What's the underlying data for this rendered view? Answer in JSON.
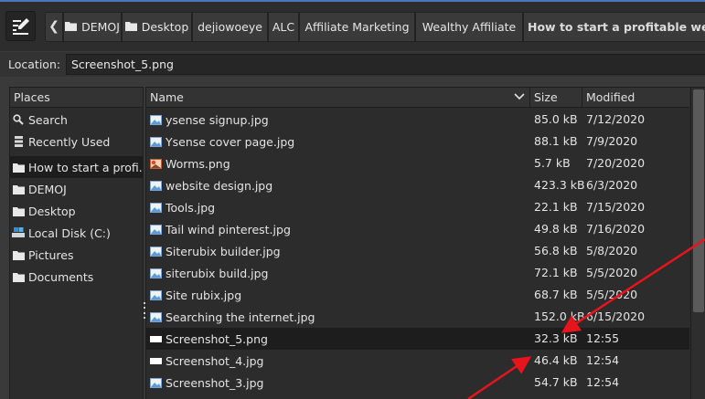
{
  "breadcrumbs": [
    "DEMOJ",
    "Desktop",
    "dejiowoeye",
    "ALC",
    "Affiliate Marketing",
    "Wealthy Affiliate",
    "How to start a profitable webs"
  ],
  "location": {
    "label": "Location:",
    "value": "Screenshot_5.png"
  },
  "places": {
    "header": "Places",
    "items": [
      {
        "label": "Search",
        "icon": "search-icon"
      },
      {
        "label": "Recently Used",
        "icon": "recent-icon"
      },
      {
        "label": "How to start a profi...",
        "icon": "folder-icon"
      },
      {
        "label": "DEMOJ",
        "icon": "folder-icon"
      },
      {
        "label": "Desktop",
        "icon": "folder-icon"
      },
      {
        "label": "Local Disk (C:)",
        "icon": "drive-icon"
      },
      {
        "label": "Pictures",
        "icon": "folder-icon"
      },
      {
        "label": "Documents",
        "icon": "folder-icon"
      }
    ]
  },
  "files": {
    "columns": {
      "name": "Name",
      "size": "Size",
      "modified": "Modified"
    },
    "rows": [
      {
        "name": "ysense signup.jpg",
        "size": "85.0 kB",
        "modified": "7/12/2020",
        "icon": "image-file-icon"
      },
      {
        "name": "Ysense cover page.jpg",
        "size": "88.1 kB",
        "modified": "7/9/2020",
        "icon": "image-file-icon"
      },
      {
        "name": "Worms.png",
        "size": "5.7 kB",
        "modified": "7/20/2020",
        "icon": "image-file-icon"
      },
      {
        "name": "website design.jpg",
        "size": "423.3 kB",
        "modified": "6/3/2020",
        "icon": "image-file-icon"
      },
      {
        "name": "Tools.jpg",
        "size": "22.1 kB",
        "modified": "7/15/2020",
        "icon": "image-file-icon"
      },
      {
        "name": "Tail wind pinterest.jpg",
        "size": "49.8 kB",
        "modified": "7/16/2020",
        "icon": "image-file-icon"
      },
      {
        "name": "Siterubix builder.jpg",
        "size": "56.8 kB",
        "modified": "5/8/2020",
        "icon": "image-file-icon"
      },
      {
        "name": "siterubix build.jpg",
        "size": "72.1 kB",
        "modified": "5/5/2020",
        "icon": "image-file-icon"
      },
      {
        "name": "Site rubix.jpg",
        "size": "68.7 kB",
        "modified": "5/5/2020",
        "icon": "image-file-icon"
      },
      {
        "name": "Searching the internet.jpg",
        "size": "152.0 kB",
        "modified": "6/15/2020",
        "icon": "image-file-icon"
      },
      {
        "name": "Screenshot_5.png",
        "size": "32.3 kB",
        "modified": "12:55",
        "icon": "image-file-icon"
      },
      {
        "name": "Screenshot_4.jpg",
        "size": "46.4 kB",
        "modified": "12:54",
        "icon": "image-file-icon"
      },
      {
        "name": "Screenshot_3.jpg",
        "size": "54.7 kB",
        "modified": "12:54",
        "icon": "image-file-icon"
      }
    ]
  },
  "colors": {
    "accent_bar": "#4a78b8",
    "annotation_arrow": "#e8141c",
    "selected_row": "#1d1d1d"
  }
}
